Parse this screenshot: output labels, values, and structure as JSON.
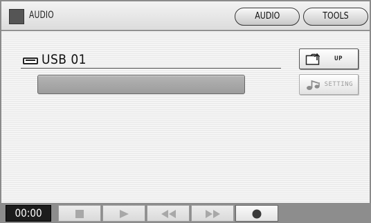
{
  "titlebar": {
    "title": "AUDIO",
    "tabs": [
      {
        "label": "AUDIO"
      },
      {
        "label": "TOOLS"
      }
    ]
  },
  "main": {
    "device_label": "USB 01",
    "file_bar_value": "",
    "side_buttons": [
      {
        "label": "UP",
        "icon": "folder-up-icon"
      },
      {
        "label": "SETTING",
        "icon": "music-notes-icon",
        "disabled": true
      }
    ]
  },
  "transport": {
    "time": "00:00",
    "buttons": [
      {
        "icon": "stop-icon",
        "disabled": true
      },
      {
        "icon": "play-icon",
        "disabled": true
      },
      {
        "icon": "rewind-icon",
        "disabled": true
      },
      {
        "icon": "fast-forward-icon",
        "disabled": true
      },
      {
        "icon": "record-icon",
        "disabled": false
      }
    ]
  },
  "colors": {
    "frame": "#8a8a8a",
    "panel": "#f2f2f2",
    "title_square": "#555555",
    "time_bg": "#1c1c1c",
    "disabled_glyph": "#a8a8a8",
    "record_glyph": "#3a3a3a"
  }
}
